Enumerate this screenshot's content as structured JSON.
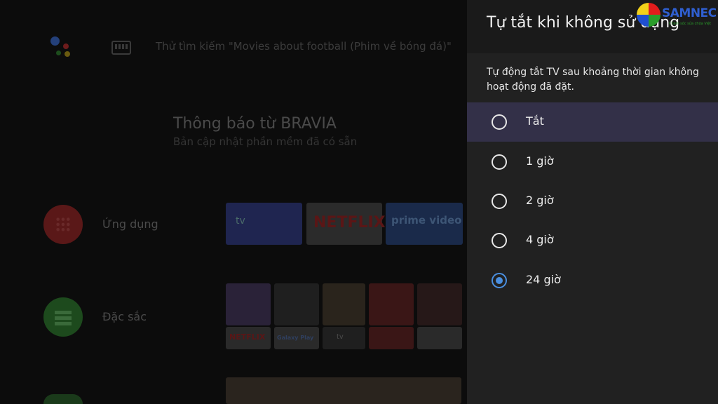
{
  "home": {
    "search_hint": "Thử tìm kiếm \"Movies about football (Phim về bóng đá)\"",
    "notification": {
      "title": "Thông báo từ BRAVIA",
      "subtitle": "Bản cập nhật phần mềm đã có sẵn"
    },
    "rows": [
      {
        "label": "Ứng dụng",
        "icon": "apps-grid-icon",
        "color": "#5a1818"
      },
      {
        "label": "Đặc sắc",
        "icon": "featured-icon",
        "color": "#1d4a1d"
      }
    ],
    "app_tiles": [
      "tv",
      "NETFLIX",
      "prime video"
    ],
    "featured_tiles": [
      "NETFLIX",
      "Galaxy Play",
      "tv"
    ]
  },
  "panel": {
    "title": "Tự tắt khi không sử dụng",
    "description": "Tự động tắt TV sau khoảng thời gian không hoạt động đã đặt.",
    "options": [
      {
        "label": "Tắt",
        "selected": false,
        "focused": true
      },
      {
        "label": "1 giờ",
        "selected": false,
        "focused": false
      },
      {
        "label": "2 giờ",
        "selected": false,
        "focused": false
      },
      {
        "label": "4 giờ",
        "selected": false,
        "focused": false
      },
      {
        "label": "24 giờ",
        "selected": true,
        "focused": false
      }
    ]
  },
  "watermark": {
    "brand": "SAMNEC",
    "tagline": "Chăm sóc sửa chữa Việt"
  },
  "colors": {
    "accent": "#4a8fe0",
    "focus_row": "#333048",
    "panel_bg": "#212121"
  }
}
